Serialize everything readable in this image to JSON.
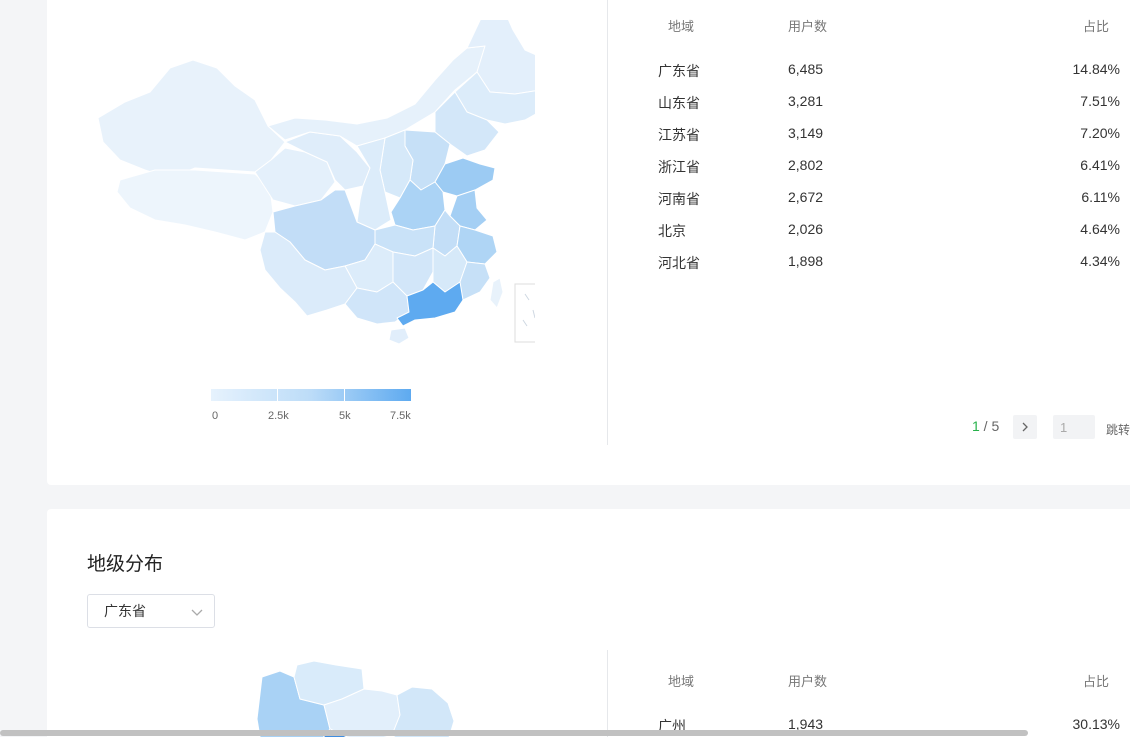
{
  "province_panel": {
    "map": {
      "name": "china-province-map",
      "highlight_color": "#5eaaf0"
    },
    "legend": {
      "ticks": [
        "0",
        "2.5k",
        "5k",
        "7.5k"
      ]
    },
    "table": {
      "headers": {
        "region": "地域",
        "users": "用户数",
        "share": "占比"
      },
      "rows": [
        {
          "region": "广东省",
          "users": "6,485",
          "share": "14.84%"
        },
        {
          "region": "山东省",
          "users": "3,281",
          "share": "7.51%"
        },
        {
          "region": "江苏省",
          "users": "3,149",
          "share": "7.20%"
        },
        {
          "region": "浙江省",
          "users": "2,802",
          "share": "6.41%"
        },
        {
          "region": "河南省",
          "users": "2,672",
          "share": "6.11%"
        },
        {
          "region": "北京",
          "users": "2,026",
          "share": "4.64%"
        },
        {
          "region": "河北省",
          "users": "1,898",
          "share": "4.34%"
        }
      ]
    },
    "pagination": {
      "current": "1",
      "separator": " / ",
      "total": "5",
      "jump_value": "1",
      "jump_label": "跳转",
      "accent": "#27b14a"
    }
  },
  "city_panel": {
    "title": "地级分布",
    "province_select": {
      "value": "广东省"
    },
    "table": {
      "headers": {
        "region": "地域",
        "users": "用户数",
        "share": "占比"
      },
      "rows": [
        {
          "region": "广州",
          "users": "1,943",
          "share": "30.13%"
        }
      ]
    }
  }
}
